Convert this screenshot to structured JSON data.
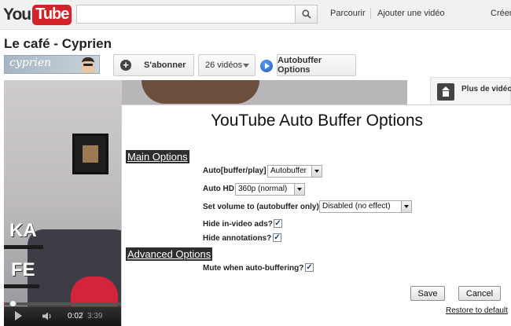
{
  "header": {
    "logo_you": "You",
    "logo_tube": "Tube",
    "search_placeholder": "",
    "browse_link": "Parcourir",
    "upload_link": "Ajouter une vidéo",
    "create_link": "Créer"
  },
  "video": {
    "title": "Le café - Cyprien",
    "channel_signature": "cyprien",
    "subscribe_label": "S'abonner",
    "videos_label": "26 vidéos",
    "autobuffer_label": "Autobuffer Options",
    "frame_letters_top": "KA",
    "frame_letters_bottom": "FE"
  },
  "player": {
    "current_time": "0:02",
    "separator": "/",
    "total_time": "3:39",
    "progress_fraction": 0.009
  },
  "sidebar": {
    "more_videos": "Plus de vidéos"
  },
  "dialog": {
    "title": "YouTube Auto Buffer Options",
    "main_section": "Main Options",
    "advanced_section": "Advanced Options",
    "auto_label": "Auto[buffer/play]",
    "auto_value": "Autobuffer",
    "hd_label": "Auto HD",
    "hd_value": "360p (normal)",
    "volume_label": "Set volume to (autobuffer only):",
    "volume_value": "Disabled (no effect)",
    "hide_ads_label": "Hide in-video ads?",
    "hide_ads_checked": true,
    "hide_annotations_label": "Hide annotations?",
    "hide_annotations_checked": true,
    "mute_label": "Mute when auto-buffering?",
    "mute_checked": true,
    "checkmark": "✓",
    "save_label": "Save",
    "cancel_label": "Cancel",
    "restore_label": "Restore to default"
  },
  "colors": {
    "brand_red": "#d2232a",
    "header_bg": "#f1f1f1",
    "section_head_bg": "#2e2e2e"
  }
}
